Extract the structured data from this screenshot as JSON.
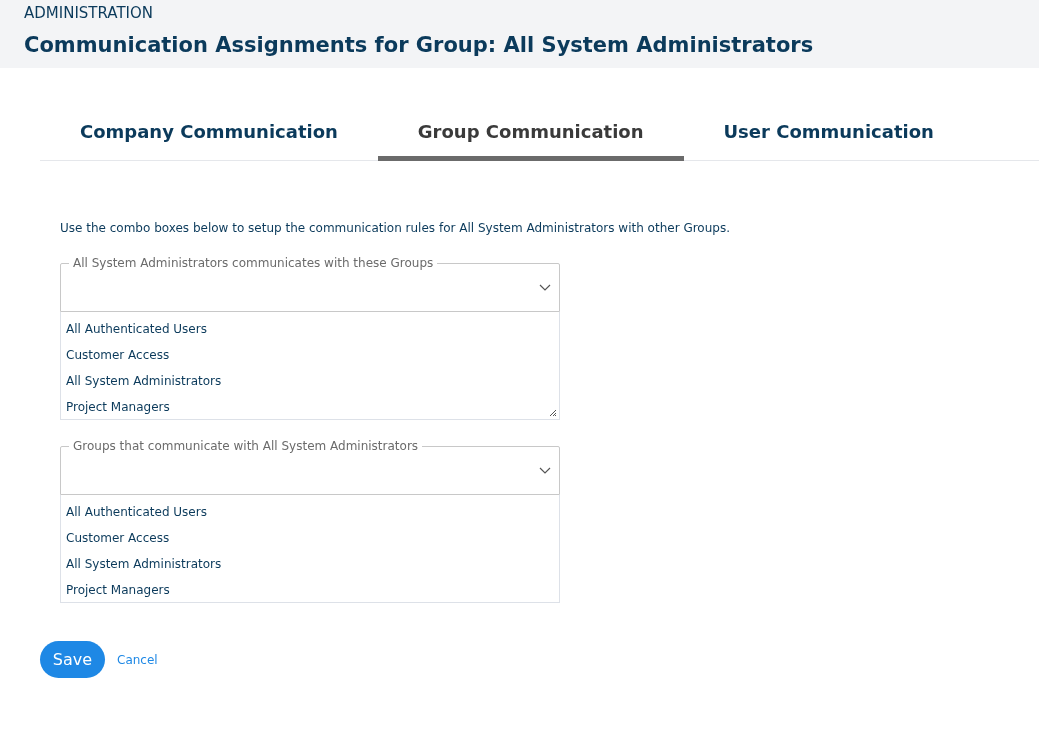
{
  "header": {
    "section": "ADMINISTRATION",
    "title": "Communication Assignments for Group: All System Administrators"
  },
  "tabs": [
    {
      "label": "Company Communication",
      "selected": false
    },
    {
      "label": "Group Communication",
      "selected": true
    },
    {
      "label": "User Communication",
      "selected": false
    }
  ],
  "description": "Use the combo boxes below to setup the communication rules for All System Administrators with other Groups.",
  "combos": [
    {
      "legend": "All System Administrators communicates with these Groups",
      "resizable": true,
      "options": [
        "All Authenticated Users",
        "Customer Access",
        "All System Administrators",
        "Project Managers"
      ]
    },
    {
      "legend": "Groups that communicate with All System Administrators",
      "resizable": false,
      "options": [
        "All Authenticated Users",
        "Customer Access",
        "All System Administrators",
        "Project Managers"
      ]
    }
  ],
  "buttons": {
    "save": "Save",
    "cancel": "Cancel"
  }
}
